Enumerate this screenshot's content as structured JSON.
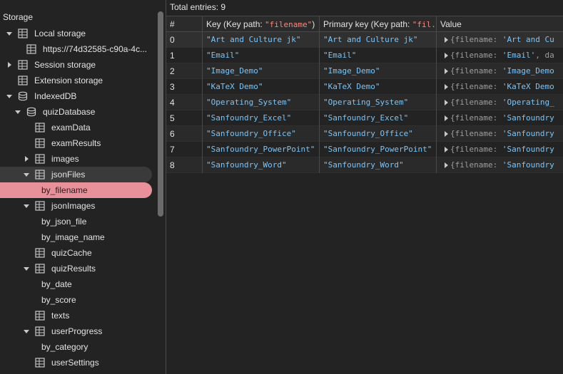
{
  "sidebar": {
    "header": "Storage",
    "items": [
      {
        "label": "Local storage",
        "icon": "table-icon",
        "expander": "down"
      },
      {
        "label": "https://74d32585-c90a-4c...",
        "icon": "table-icon",
        "expander": ""
      },
      {
        "label": "Session storage",
        "icon": "table-icon",
        "expander": "right"
      },
      {
        "label": "Extension storage",
        "icon": "table-icon",
        "expander": ""
      },
      {
        "label": "IndexedDB",
        "icon": "database-icon",
        "expander": "down"
      },
      {
        "label": "quizDatabase",
        "icon": "database-icon",
        "expander": "down"
      },
      {
        "label": "examData",
        "icon": "table-icon",
        "expander": ""
      },
      {
        "label": "examResults",
        "icon": "table-icon",
        "expander": ""
      },
      {
        "label": "images",
        "icon": "table-icon",
        "expander": "right"
      },
      {
        "label": "jsonFiles",
        "icon": "table-icon",
        "expander": "down"
      },
      {
        "label": "by_filename",
        "icon": "",
        "expander": ""
      },
      {
        "label": "jsonImages",
        "icon": "table-icon",
        "expander": "down"
      },
      {
        "label": "by_json_file",
        "icon": "",
        "expander": ""
      },
      {
        "label": "by_image_name",
        "icon": "",
        "expander": ""
      },
      {
        "label": "quizCache",
        "icon": "table-icon",
        "expander": ""
      },
      {
        "label": "quizResults",
        "icon": "table-icon",
        "expander": "down"
      },
      {
        "label": "by_date",
        "icon": "",
        "expander": ""
      },
      {
        "label": "by_score",
        "icon": "",
        "expander": ""
      },
      {
        "label": "texts",
        "icon": "table-icon",
        "expander": ""
      },
      {
        "label": "userProgress",
        "icon": "table-icon",
        "expander": "down"
      },
      {
        "label": "by_category",
        "icon": "",
        "expander": ""
      },
      {
        "label": "userSettings",
        "icon": "table-icon",
        "expander": ""
      }
    ]
  },
  "main": {
    "total_entries": "Total entries: 9",
    "columns": {
      "index": "#",
      "key_prefix": "Key (Key path: ",
      "key_path": "\"filename\"",
      "key_suffix": ")",
      "primary_prefix": "Primary key (Key path: ",
      "primary_path": "\"fil...",
      "value": "Value"
    },
    "rows": [
      {
        "idx": "0",
        "key": "\"Art and Culture jk\"",
        "primary": "\"Art and Culture jk\"",
        "value_str": "'Art and Cu",
        "value_tail": ""
      },
      {
        "idx": "1",
        "key": "\"Email\"",
        "primary": "\"Email\"",
        "value_str": "'Email'",
        "value_tail": ", da"
      },
      {
        "idx": "2",
        "key": "\"Image_Demo\"",
        "primary": "\"Image_Demo\"",
        "value_str": "'Image_Demo",
        "value_tail": ""
      },
      {
        "idx": "3",
        "key": "\"KaTeX Demo\"",
        "primary": "\"KaTeX Demo\"",
        "value_str": "'KaTeX Demo",
        "value_tail": ""
      },
      {
        "idx": "4",
        "key": "\"Operating_System\"",
        "primary": "\"Operating_System\"",
        "value_str": "'Operating_",
        "value_tail": ""
      },
      {
        "idx": "5",
        "key": "\"Sanfoundry_Excel\"",
        "primary": "\"Sanfoundry_Excel\"",
        "value_str": "'Sanfoundry",
        "value_tail": ""
      },
      {
        "idx": "6",
        "key": "\"Sanfoundry_Office\"",
        "primary": "\"Sanfoundry_Office\"",
        "value_str": "'Sanfoundry",
        "value_tail": ""
      },
      {
        "idx": "7",
        "key": "\"Sanfoundry_PowerPoint\"",
        "primary": "\"Sanfoundry_PowerPoint\"",
        "value_str": "'Sanfoundry",
        "value_tail": ""
      },
      {
        "idx": "8",
        "key": "\"Sanfoundry_Word\"",
        "primary": "\"Sanfoundry_Word\"",
        "value_str": "'Sanfoundry",
        "value_tail": ""
      }
    ],
    "value_prefix": "{filename: "
  },
  "colors": {
    "selected_bg": "#e9919a",
    "string_blue": "#7cc4f7",
    "keypath_red": "#f28b82",
    "background": "#232323"
  }
}
